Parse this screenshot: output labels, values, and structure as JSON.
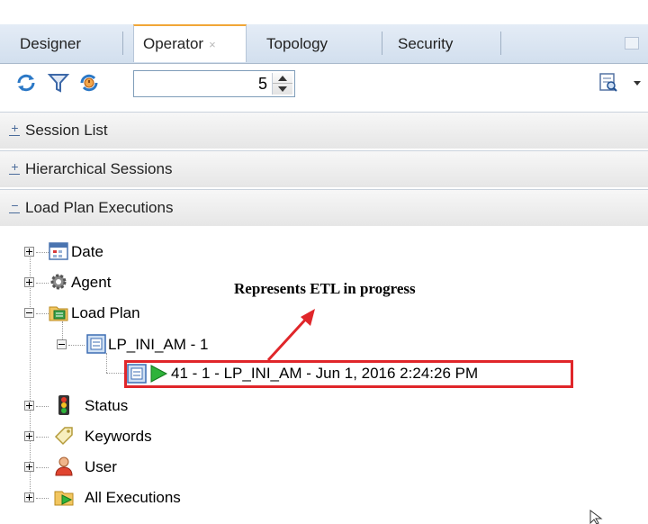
{
  "tabs": [
    {
      "label": "Designer"
    },
    {
      "label": "Operator",
      "close": "×",
      "active": true
    },
    {
      "label": "Topology"
    },
    {
      "label": "Security"
    }
  ],
  "toolbar": {
    "icons": [
      "refresh-icon",
      "filter-icon",
      "scheduler-refresh-icon",
      "search-dropdown-icon"
    ],
    "count_value": "5"
  },
  "panels": [
    {
      "label": "Session List",
      "state": "+"
    },
    {
      "label": "Hierarchical Sessions",
      "state": "+"
    },
    {
      "label": "Load Plan Executions",
      "state": "−"
    }
  ],
  "tree": {
    "date": "Date",
    "agent": "Agent",
    "load_plan": "Load Plan",
    "lp_node": "LP_INI_AM - 1",
    "execution": "41 - 1 - LP_INI_AM - Jun 1, 2016 2:24:26 PM",
    "status": "Status",
    "keywords": "Keywords",
    "user": "User",
    "all_executions": "All Executions"
  },
  "annotation": "Represents ETL in progress",
  "colors": {
    "highlight": "#e0262a",
    "active_tab_accent": "#f1a637",
    "tab_bar": "#d8e3f0"
  }
}
